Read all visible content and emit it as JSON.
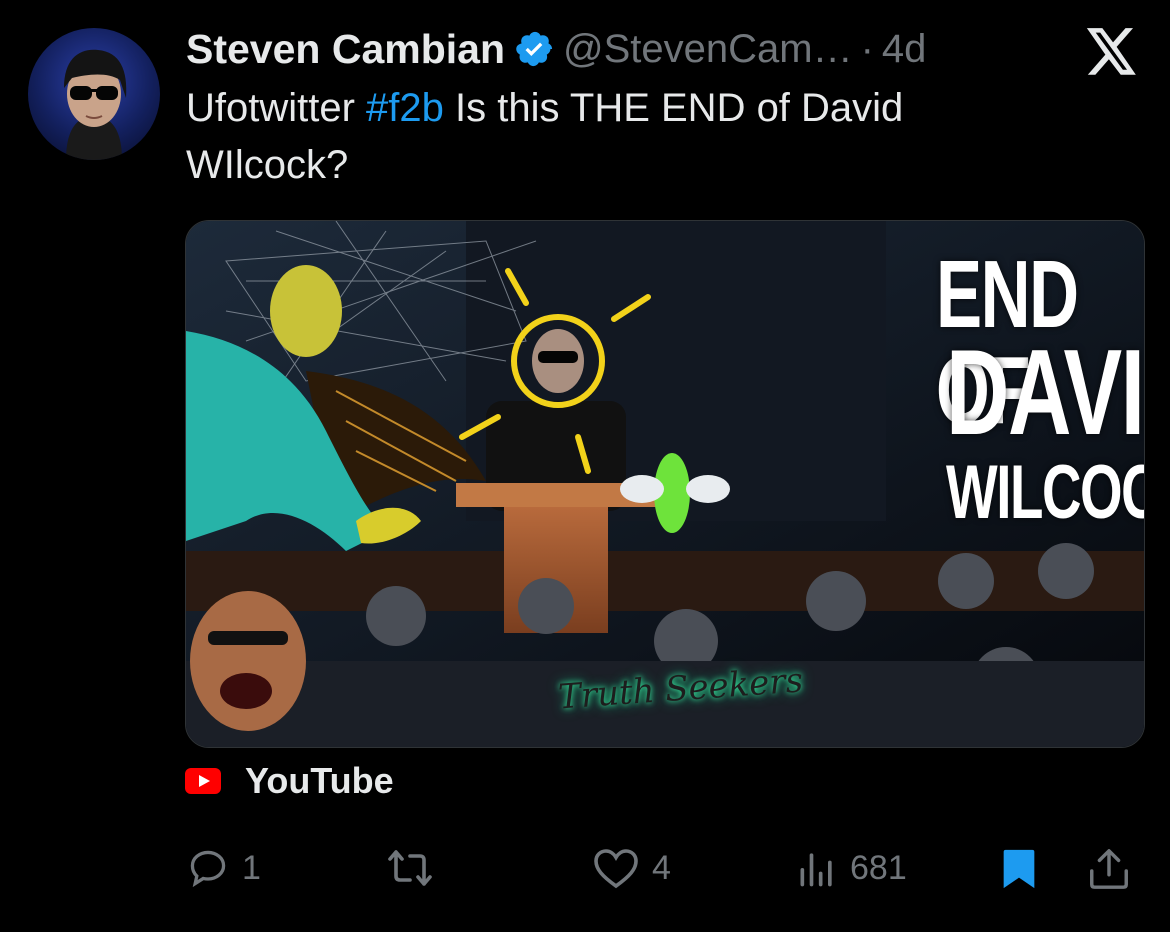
{
  "tweet": {
    "author_name": "Steven Cambian",
    "handle": "@StevenCam…",
    "separator": "·",
    "time": "4d",
    "text_before": "Ufotwitter ",
    "hashtag": "#f2b",
    "text_after": " Is this THE END of David WIlcock?"
  },
  "card": {
    "headline_line1": "END OF",
    "headline_line2": "DAVID",
    "headline_line3": "WILCOCK?",
    "signature": "Truth Seekers",
    "source": "YouTube"
  },
  "actions": {
    "replies": "1",
    "reposts": "",
    "likes": "4",
    "views": "681"
  },
  "colors": {
    "accent": "#1d9bf0",
    "muted": "#71767b",
    "bookmark_active": "#1d9bf0",
    "youtube_red": "#ff0000"
  },
  "icons": {
    "verified": "verified-badge-icon",
    "platform": "x-logo-icon",
    "reply": "reply-icon",
    "repost": "repost-icon",
    "like": "heart-icon",
    "views": "views-icon",
    "bookmark": "bookmark-icon",
    "share": "share-icon"
  }
}
